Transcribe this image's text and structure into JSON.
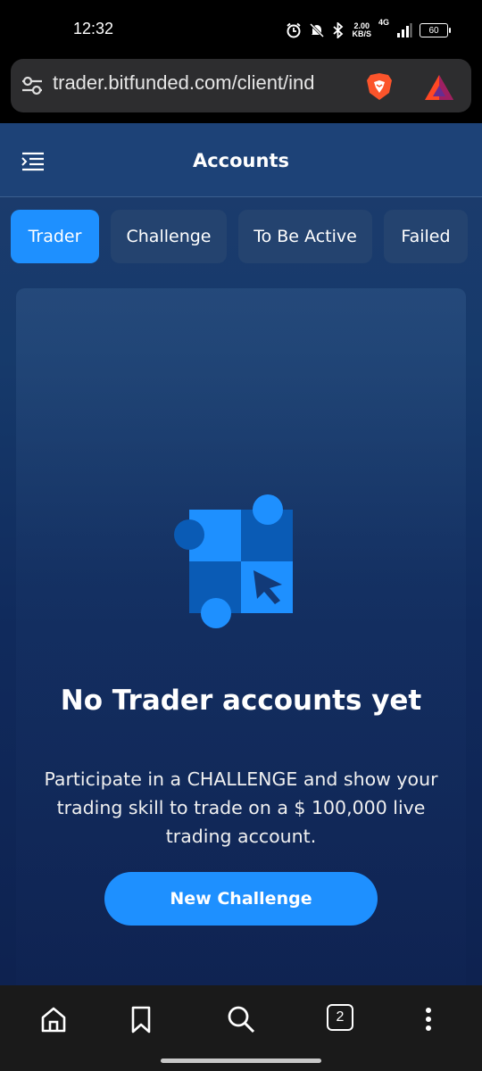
{
  "status": {
    "time": "12:32",
    "speed_value": "2.00",
    "speed_unit": "KB/S",
    "network": "4G",
    "battery": "60"
  },
  "browser": {
    "url": "trader.bitfunded.com/client/ind",
    "open_tabs": "2"
  },
  "header": {
    "title": "Accounts"
  },
  "tabs": [
    {
      "label": "Trader",
      "active": true
    },
    {
      "label": "Challenge",
      "active": false
    },
    {
      "label": "To Be Active",
      "active": false
    },
    {
      "label": "Failed",
      "active": false
    }
  ],
  "empty_state": {
    "title": "No Trader accounts yet",
    "description": "Participate in a CHALLENGE and show your trading skill to trade on a $ 100,000 live trading account.",
    "button_label": "New Challenge"
  },
  "colors": {
    "accent": "#1e90ff",
    "header_bg": "#1d4277",
    "tab_bg": "#24436f"
  },
  "icons": [
    "alarm-icon",
    "mute-icon",
    "bluetooth-icon",
    "signal-icon",
    "battery-icon",
    "tune-icon",
    "brave-icon",
    "bat-icon",
    "menu-icon",
    "home-icon",
    "bookmark-icon",
    "search-icon",
    "tabs-icon",
    "more-icon"
  ]
}
